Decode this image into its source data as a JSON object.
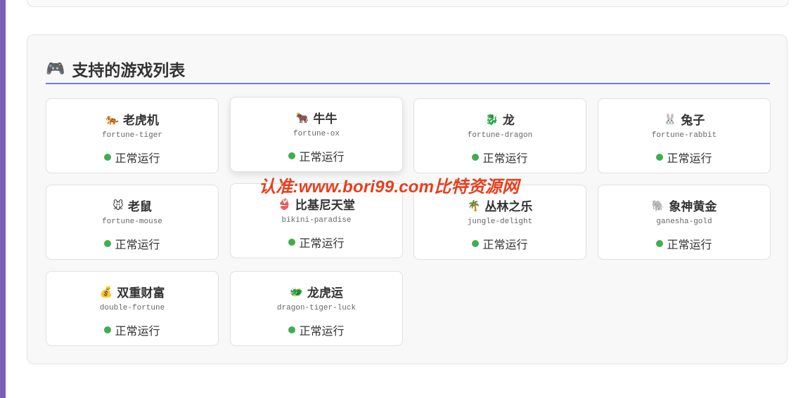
{
  "section": {
    "title": "支持的游戏列表",
    "icon": "🎮"
  },
  "games": [
    {
      "icon": "🐅",
      "name": "老虎机",
      "code": "fortune-tiger",
      "status": "正常运行"
    },
    {
      "icon": "🐂",
      "name": "牛牛",
      "code": "fortune-ox",
      "status": "正常运行"
    },
    {
      "icon": "🐉",
      "name": "龙",
      "code": "fortune-dragon",
      "status": "正常运行"
    },
    {
      "icon": "🐰",
      "name": "兔子",
      "code": "fortune-rabbit",
      "status": "正常运行"
    },
    {
      "icon": "🐭",
      "name": "老鼠",
      "code": "fortune-mouse",
      "status": "正常运行"
    },
    {
      "icon": "👙",
      "name": "比基尼天堂",
      "code": "bikini-paradise",
      "status": "正常运行"
    },
    {
      "icon": "🌴",
      "name": "丛林之乐",
      "code": "jungle-delight",
      "status": "正常运行"
    },
    {
      "icon": "🐘",
      "name": "象神黄金",
      "code": "ganesha-gold",
      "status": "正常运行"
    },
    {
      "icon": "💰",
      "name": "双重财富",
      "code": "double-fortune",
      "status": "正常运行"
    },
    {
      "icon": "🐲",
      "name": "龙虎运",
      "code": "dragon-tiger-luck",
      "status": "正常运行"
    }
  ],
  "status_color": "#3fae4f",
  "accent_color": "#667ee0",
  "watermark": "认准:www.bori99.com比特资源网"
}
